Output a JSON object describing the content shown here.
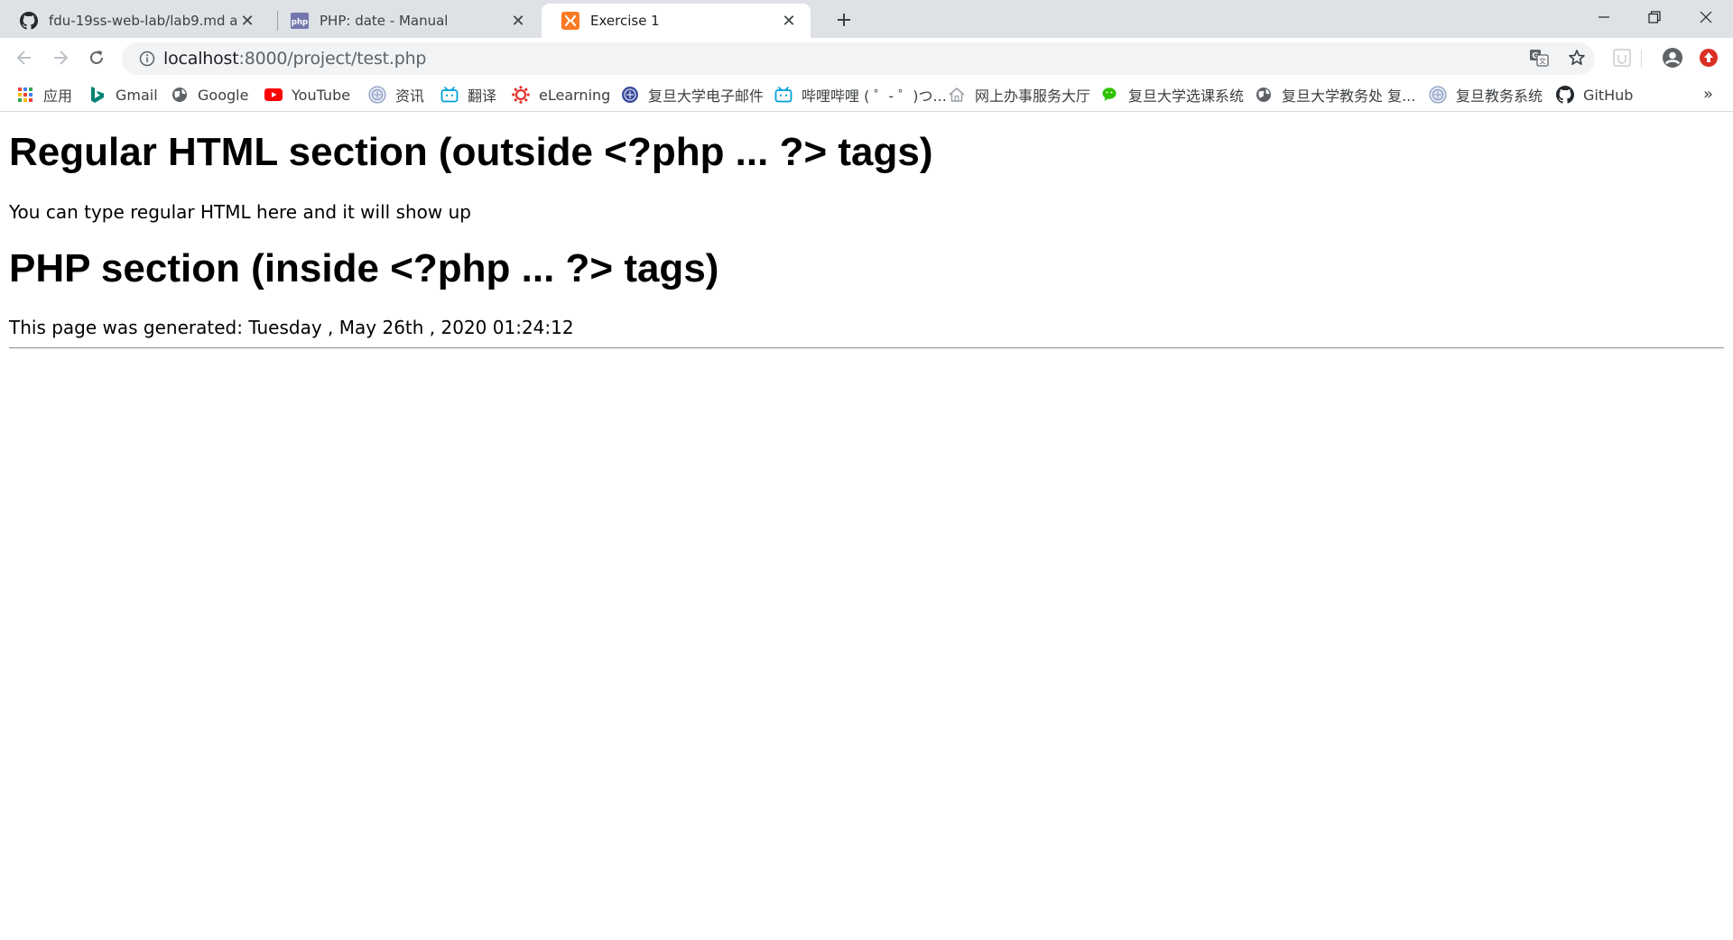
{
  "tabs": [
    {
      "title": "fdu-19ss-web-lab/lab9.md at m",
      "icon": "github-icon",
      "active": false
    },
    {
      "title": "PHP: date - Manual",
      "icon": "php-icon",
      "active": false
    },
    {
      "title": "Exercise 1",
      "icon": "xampp-icon",
      "active": true
    }
  ],
  "toolbar": {
    "url_host": "localhost",
    "url_path": ":8000/project/test.php"
  },
  "bookmarks": [
    {
      "label": "应用",
      "icon": "apps-grid-icon"
    },
    {
      "label": "Gmail",
      "icon": "bing-icon"
    },
    {
      "label": "Google",
      "icon": "globe-icon"
    },
    {
      "label": "YouTube",
      "icon": "youtube-icon"
    },
    {
      "label": "资讯",
      "icon": "fudan-icon"
    },
    {
      "label": "翻译",
      "icon": "bilibili-icon"
    },
    {
      "label": "eLearning",
      "icon": "canvas-icon"
    },
    {
      "label": "复旦大学电子邮件",
      "icon": "fudan-mail-icon"
    },
    {
      "label": "哔哩哔哩 ( ゜- ゜)つ...",
      "icon": "bilibili-icon"
    },
    {
      "label": "网上办事服务大厅",
      "icon": "house-icon"
    },
    {
      "label": "复旦大学选课系统",
      "icon": "wechat-icon"
    },
    {
      "label": "复旦大学教务处 复...",
      "icon": "globe-icon"
    },
    {
      "label": "复旦教务系统",
      "icon": "fudan-icon"
    },
    {
      "label": "GitHub",
      "icon": "github-icon"
    }
  ],
  "page": {
    "heading1": "Regular HTML section (outside <?php ... ?> tags)",
    "paragraph1": "You can type regular HTML here and it will show up",
    "heading2": "PHP section (inside <?php ... ?> tags)",
    "paragraph2": "This page was generated: Tuesday , May 26th , 2020 01:24:12"
  },
  "colors": {
    "tabstrip_bg": "#dee1e6",
    "omnibox_bg": "#f1f3f4",
    "youtube_red": "#ff0000",
    "xampp_orange": "#fb7a24",
    "extension_red": "#d93025"
  }
}
